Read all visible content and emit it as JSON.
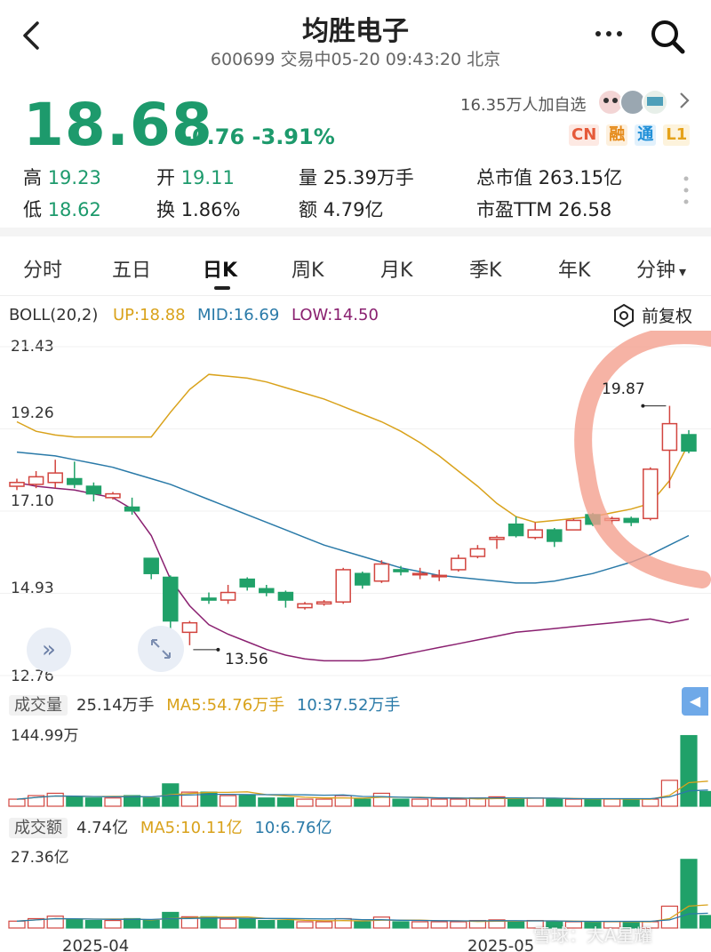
{
  "header": {
    "title": "均胜电子",
    "subtitle": "600699 交易中05-20 09:43:20 北京",
    "back_icon": "chevron-left-icon",
    "more_icon": "more-dots-icon",
    "search_icon": "search-icon"
  },
  "quote": {
    "price": "18.68",
    "change": "-0.76 -3.91%",
    "followers": "16.35万人加自选",
    "badges": [
      "CN",
      "融",
      "通",
      "L1"
    ]
  },
  "stats": {
    "high_label": "高",
    "high": "19.23",
    "open_label": "开",
    "open": "19.11",
    "vol_label": "量",
    "vol": "25.39万手",
    "mcap_label": "总市值",
    "mcap": "263.15亿",
    "low_label": "低",
    "low": "18.62",
    "turn_label": "换",
    "turn": "1.86%",
    "amt_label": "额",
    "amt": "4.79亿",
    "pe_label": "市盈TTM",
    "pe": "26.58"
  },
  "tabs": [
    "分时",
    "五日",
    "日K",
    "周K",
    "月K",
    "季K",
    "年K",
    "分钟"
  ],
  "active_tab": "日K",
  "minute_caret": "▾",
  "boll": {
    "label": "BOLL(20,2)",
    "up": "UP:18.88",
    "mid": "MID:16.69",
    "low": "LOW:14.50",
    "adjust": "前复权",
    "colors": {
      "up": "#d9a21b",
      "mid": "#2a7aa8",
      "low": "#8a2070",
      "rise": "#d2453f",
      "fall": "#20a169"
    }
  },
  "chart_data": {
    "type": "candlestick",
    "ylim": [
      12.76,
      21.43
    ],
    "y_ticks": [
      "21.43",
      "19.26",
      "17.10",
      "14.93",
      "12.76"
    ],
    "annotations": {
      "high": "19.87",
      "low": "13.56"
    },
    "candles": [
      {
        "o": 17.75,
        "c": 17.85,
        "h": 17.95,
        "l": 17.65
      },
      {
        "o": 17.8,
        "c": 18.0,
        "h": 18.15,
        "l": 17.7
      },
      {
        "o": 17.85,
        "c": 18.1,
        "h": 18.45,
        "l": 17.7
      },
      {
        "o": 17.95,
        "c": 17.8,
        "h": 18.4,
        "l": 17.7
      },
      {
        "o": 17.75,
        "c": 17.55,
        "h": 17.85,
        "l": 17.35
      },
      {
        "o": 17.45,
        "c": 17.55,
        "h": 17.6,
        "l": 17.4
      },
      {
        "o": 17.2,
        "c": 17.1,
        "h": 17.45,
        "l": 17.0
      },
      {
        "o": 15.85,
        "c": 15.45,
        "h": 15.85,
        "l": 15.3
      },
      {
        "o": 15.35,
        "c": 14.2,
        "h": 15.4,
        "l": 14.0
      },
      {
        "o": 13.9,
        "c": 14.15,
        "h": 14.2,
        "l": 13.56
      },
      {
        "o": 14.8,
        "c": 14.75,
        "h": 14.95,
        "l": 14.65
      },
      {
        "o": 14.75,
        "c": 14.95,
        "h": 15.15,
        "l": 14.65
      },
      {
        "o": 15.3,
        "c": 15.1,
        "h": 15.35,
        "l": 15.0
      },
      {
        "o": 15.05,
        "c": 14.95,
        "h": 15.15,
        "l": 14.85
      },
      {
        "o": 14.95,
        "c": 14.75,
        "h": 15.0,
        "l": 14.55
      },
      {
        "o": 14.55,
        "c": 14.65,
        "h": 14.7,
        "l": 14.5
      },
      {
        "o": 14.65,
        "c": 14.7,
        "h": 14.75,
        "l": 14.6
      },
      {
        "o": 14.7,
        "c": 15.55,
        "h": 15.6,
        "l": 14.65
      },
      {
        "o": 15.45,
        "c": 15.15,
        "h": 15.5,
        "l": 15.05
      },
      {
        "o": 15.25,
        "c": 15.7,
        "h": 15.8,
        "l": 15.2
      },
      {
        "o": 15.55,
        "c": 15.5,
        "h": 15.65,
        "l": 15.4
      },
      {
        "o": 15.45,
        "c": 15.45,
        "h": 15.6,
        "l": 15.3
      },
      {
        "o": 15.4,
        "c": 15.4,
        "h": 15.55,
        "l": 15.25
      },
      {
        "o": 15.55,
        "c": 15.85,
        "h": 15.95,
        "l": 15.5
      },
      {
        "o": 15.9,
        "c": 16.1,
        "h": 16.2,
        "l": 15.85
      },
      {
        "o": 16.35,
        "c": 16.4,
        "h": 16.45,
        "l": 16.1
      },
      {
        "o": 16.75,
        "c": 16.45,
        "h": 16.95,
        "l": 16.4
      },
      {
        "o": 16.4,
        "c": 16.6,
        "h": 16.8,
        "l": 16.35
      },
      {
        "o": 16.6,
        "c": 16.3,
        "h": 16.65,
        "l": 16.15
      },
      {
        "o": 16.6,
        "c": 16.85,
        "h": 16.9,
        "l": 16.6
      },
      {
        "o": 17.0,
        "c": 16.75,
        "h": 17.05,
        "l": 16.7
      },
      {
        "o": 16.85,
        "c": 16.9,
        "h": 16.95,
        "l": 16.75
      },
      {
        "o": 16.9,
        "c": 16.8,
        "h": 16.95,
        "l": 16.7
      },
      {
        "o": 16.9,
        "c": 18.2,
        "h": 18.25,
        "l": 16.85
      },
      {
        "o": 18.7,
        "c": 19.4,
        "h": 19.87,
        "l": 17.7
      },
      {
        "o": 19.11,
        "c": 18.68,
        "h": 19.23,
        "l": 18.62
      }
    ],
    "up_line": [
      19.45,
      19.2,
      19.1,
      19.05,
      19.05,
      19.05,
      19.05,
      19.05,
      19.7,
      20.3,
      20.7,
      20.65,
      20.6,
      20.5,
      20.35,
      20.2,
      20.05,
      19.85,
      19.65,
      19.45,
      19.2,
      18.9,
      18.55,
      18.15,
      17.75,
      17.3,
      16.95,
      16.8,
      16.85,
      16.9,
      16.95,
      17.05,
      17.15,
      17.3,
      17.9,
      18.88
    ],
    "mid_line": [
      18.65,
      18.6,
      18.55,
      18.45,
      18.35,
      18.25,
      18.1,
      17.95,
      17.8,
      17.6,
      17.4,
      17.2,
      17.0,
      16.8,
      16.6,
      16.4,
      16.2,
      16.05,
      15.9,
      15.75,
      15.6,
      15.5,
      15.4,
      15.35,
      15.3,
      15.25,
      15.2,
      15.2,
      15.25,
      15.35,
      15.45,
      15.6,
      15.75,
      15.95,
      16.2,
      16.45
    ],
    "low_line": [
      17.85,
      17.75,
      17.7,
      17.65,
      17.55,
      17.45,
      17.15,
      16.45,
      15.3,
      14.6,
      14.1,
      13.85,
      13.65,
      13.45,
      13.3,
      13.2,
      13.15,
      13.15,
      13.15,
      13.2,
      13.3,
      13.4,
      13.5,
      13.6,
      13.7,
      13.8,
      13.9,
      13.95,
      14.0,
      14.05,
      14.1,
      14.15,
      14.2,
      14.25,
      14.15,
      14.25
    ],
    "volume": {
      "label": "成交量",
      "current": "25.14万手",
      "ma5": "MA5:54.76万手",
      "ma10": "10:37.52万手",
      "max_label": "144.99万",
      "max": 144.99,
      "values": [
        12,
        18,
        22,
        16,
        14,
        14,
        18,
        14,
        38,
        24,
        24,
        18,
        18,
        14,
        14,
        12,
        12,
        18,
        12,
        22,
        12,
        12,
        12,
        12,
        14,
        16,
        12,
        14,
        12,
        12,
        12,
        12,
        12,
        12,
        44,
        120,
        25
      ]
    },
    "amount": {
      "label": "成交额",
      "current": "4.74亿",
      "ma5": "MA5:10.11亿",
      "ma10": "10:6.76亿",
      "max_label": "27.36亿",
      "max": 27.36,
      "values": [
        2.2,
        3.0,
        3.8,
        2.8,
        2.4,
        2.4,
        3.0,
        2.4,
        5.0,
        3.6,
        3.6,
        2.8,
        2.8,
        2.4,
        2.4,
        2.0,
        2.0,
        3.0,
        2.0,
        3.5,
        2.0,
        2.0,
        2.0,
        2.0,
        2.4,
        2.6,
        2.0,
        2.4,
        2.0,
        2.0,
        2.0,
        2.0,
        2.0,
        2.0,
        7.0,
        22.0,
        4.0
      ]
    },
    "x_labels": [
      "2025-04",
      "2025-05"
    ]
  },
  "watermark": "雪球：大A星耀"
}
